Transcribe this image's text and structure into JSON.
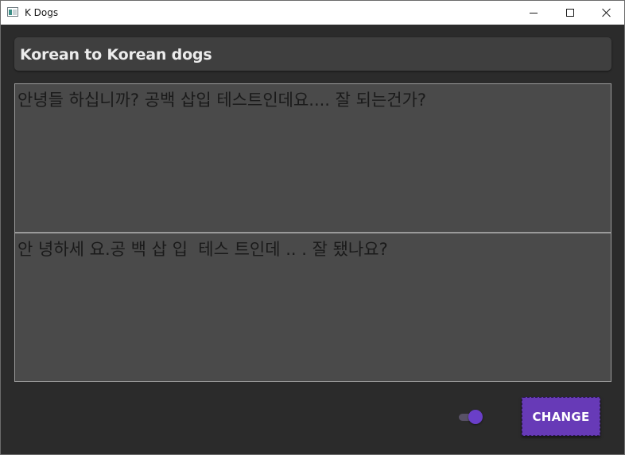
{
  "window": {
    "title": "K Dogs",
    "controls": {
      "minimize_icon": "minimize-icon",
      "maximize_icon": "maximize-icon",
      "close_icon": "close-icon"
    }
  },
  "header": {
    "title": "Korean to Korean dogs"
  },
  "input": {
    "value": "안녕들 하십니까? 공백 삽입 테스트인데요.... 잘 되는건가?"
  },
  "output": {
    "value": "안 녕하세 요.공 백 삽 입  테스 트인데 .. . 잘 됐나요?"
  },
  "toggle": {
    "state": "on"
  },
  "actions": {
    "change_label": "CHANGE"
  },
  "colors": {
    "background": "#2b2b2b",
    "accent": "#673ab7",
    "panel": "#3f3f3f",
    "text_area": "#4a4a4a"
  }
}
